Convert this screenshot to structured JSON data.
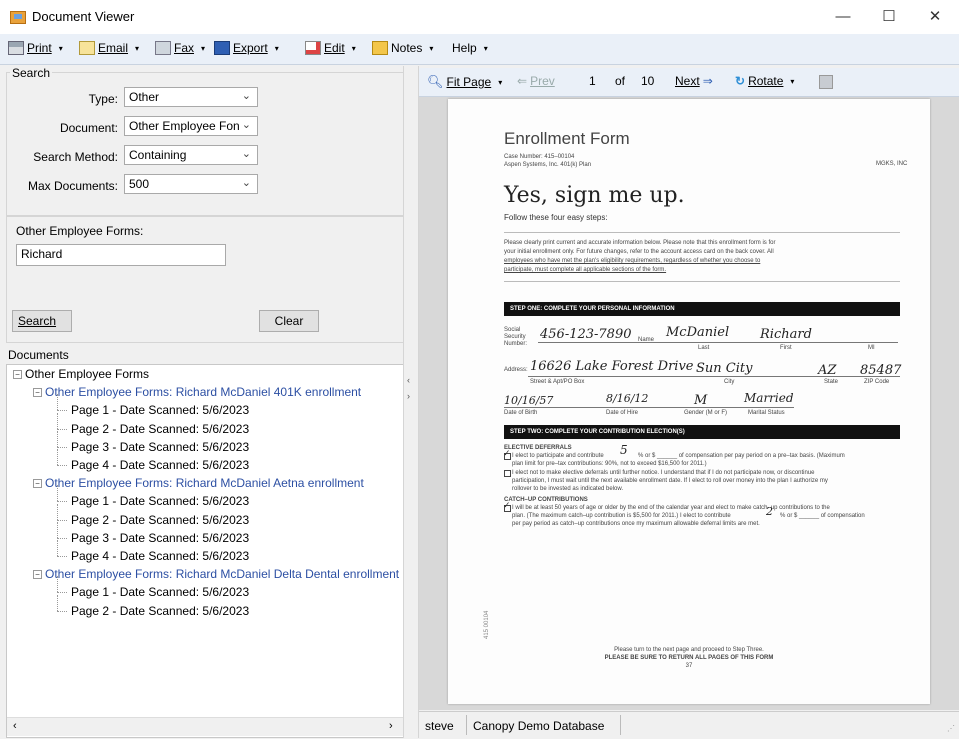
{
  "window": {
    "title": "Document Viewer",
    "minimize": "—",
    "maximize": "☐",
    "close": "✕"
  },
  "toolbar": {
    "print": "Print",
    "email": "Email",
    "fax": "Fax",
    "export": "Export",
    "edit": "Edit",
    "notes": "Notes",
    "help": "Help",
    "caret": "▾"
  },
  "search": {
    "group_label": "Search",
    "type_label": "Type:",
    "type_value": "Other",
    "document_label": "Document:",
    "document_value": "Other Employee Fon",
    "method_label": "Search Method:",
    "method_value": "Containing",
    "max_label": "Max Documents:",
    "max_value": "500",
    "forms_label": "Other Employee Forms:",
    "forms_value": "Richard",
    "search_button": "Search",
    "clear_button": "Clear"
  },
  "documents": {
    "label": "Documents",
    "root": "Other Employee Forms",
    "groups": [
      {
        "title": "Other Employee Forms: Richard McDaniel 401K enrollment",
        "pages": [
          "Page 1 - Date Scanned: 5/6/2023",
          "Page 2 - Date Scanned: 5/6/2023",
          "Page 3 - Date Scanned: 5/6/2023",
          "Page 4 - Date Scanned: 5/6/2023"
        ]
      },
      {
        "title": "Other Employee Forms: Richard McDaniel Aetna enrollment",
        "pages": [
          "Page 1 - Date Scanned: 5/6/2023",
          "Page 2 - Date Scanned: 5/6/2023",
          "Page 3 - Date Scanned: 5/6/2023",
          "Page 4 - Date Scanned: 5/6/2023"
        ]
      },
      {
        "title": "Other Employee Forms: Richard McDaniel Delta Dental enrollment",
        "pages": [
          "Page 1 - Date Scanned: 5/6/2023",
          "Page 2 - Date Scanned: 5/6/2023"
        ]
      }
    ]
  },
  "viewer": {
    "fit_page": "Fit Page",
    "prev": "Prev",
    "page": "1",
    "of": "of",
    "total": "10",
    "next": "Next",
    "rotate": "Rotate"
  },
  "status": {
    "user": "steve",
    "database": "Canopy Demo Database"
  },
  "doc": {
    "title": "Enrollment Form",
    "case": "Case Number: 415–00104",
    "plan": "Aspen Systems, Inc. 401(k) Plan",
    "company": "MGKS, INC",
    "headline": "Yes, sign me up.",
    "sub": "Follow these four easy steps:",
    "intro1": "Please clearly print current and accurate information below. Please note that this enrollment form is for",
    "intro2": "your initial enrollment only. For future changes, refer to the account access card on the back cover. All",
    "intro3": "employees who have met the plan's eligibility requirements, regardless of whether you choose to",
    "intro4": "participate, must complete all applicable sections of the form.",
    "step1": "STEP ONE: COMPLETE YOUR PERSONAL INFORMATION",
    "ssn_label": "Social Security Number:",
    "ssn": "456-123-7890",
    "name_label": "Name",
    "last": "McDaniel",
    "first": "Richard",
    "last_cap": "Last",
    "first_cap": "First",
    "mi_cap": "MI",
    "addr_label": "Address:",
    "street": "16626 Lake Forest Drive",
    "city": "Sun City",
    "state": "AZ",
    "zip": "85487",
    "street_cap": "Street & Apt/PO Box",
    "city_cap": "City",
    "state_cap": "State",
    "zip_cap": "ZIP Code",
    "dob": "10/16/57",
    "doh": "8/16/12",
    "gender": "M",
    "marital": "Married",
    "dob_cap": "Date of Birth",
    "doh_cap": "Date of Hire",
    "gender_cap": "Gender (M or F)",
    "marital_cap": "Marital Status",
    "step2": "STEP TWO: COMPLETE YOUR CONTRIBUTION ELECTION(S)",
    "elective": "ELECTIVE DEFERRALS",
    "e1": "I elect to participate and contribute",
    "e1_value": "5",
    "e1b": "% or $ ______ of compensation per pay period on a pre–tax basis. (Maximum",
    "e2": "plan limit for pre–tax contributions: 90%, not to exceed $16,500 for 2011.)",
    "e3": "I elect not to make elective deferrals until further notice. I understand that if I do not participate now, or discontinue",
    "e4": "participation, I must wait until the next available enrollment date. If I elect to roll over money into the plan I authorize my",
    "e5": "rollover to be invested as indicated below.",
    "catchup": "CATCH–UP CONTRIBUTIONS",
    "c1": "I will be at least 50 years of age or older by the end of the calendar year and elect to make catch–up contributions to the",
    "c2": "plan. (The maximum catch–up contribution is $5,500 for 2011.) I elect to contribute",
    "c2_value": "2",
    "c2b": "% or $ ______ of compensation",
    "c3": "per pay period as catch–up contributions once my maximum allowable deferral limits are met.",
    "foot1": "Please turn to the next page and proceed to Step Three.",
    "foot2": "PLEASE BE SURE TO RETURN ALL PAGES OF THIS FORM",
    "pagenum": "37",
    "sidecode": "415 00104"
  }
}
